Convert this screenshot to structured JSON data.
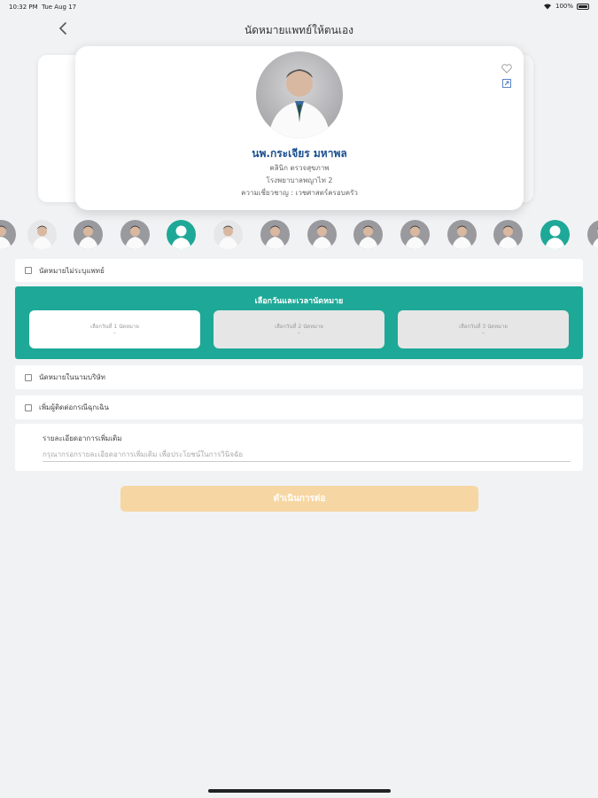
{
  "status_bar": {
    "time": "10:32 PM",
    "date": "Tue Aug 17",
    "battery": "100%"
  },
  "header": {
    "back_icon": "chevron-left-icon",
    "title": "นัดหมายแพทย์ให้ตนเอง"
  },
  "doctor": {
    "name": "นพ.กระเจียร มหาพล",
    "clinic": "คลินิก ตรวจสุขภาพ",
    "hospital": "โรงพยาบาลพญาไท 2",
    "specialty": "ความเชี่ยวชาญ : เวชศาสตร์ครอบครัว",
    "icons": [
      "heart-icon",
      "share-icon"
    ]
  },
  "avatars": [
    {
      "kind": "photo"
    },
    {
      "kind": "light"
    },
    {
      "kind": "photo"
    },
    {
      "kind": "photo"
    },
    {
      "kind": "generic"
    },
    {
      "kind": "light"
    },
    {
      "kind": "photo"
    },
    {
      "kind": "photo"
    },
    {
      "kind": "photo"
    },
    {
      "kind": "photo"
    },
    {
      "kind": "photo"
    },
    {
      "kind": "photo"
    },
    {
      "kind": "generic"
    },
    {
      "kind": "photo"
    }
  ],
  "options": {
    "no_doctor": "นัดหมายไม่ระบุแพทย์",
    "hotel_pickup": "นัดหมายในนามบริษัท",
    "emergency_contact": "เพิ่มผู้ติดต่อกรณีฉุกเฉิน"
  },
  "appointment": {
    "title": "เลือกวันและเวลานัดหมาย",
    "slots": [
      {
        "label": "เลือกวันที่ 1 นัดหมาย",
        "value": "-"
      },
      {
        "label": "เลือกวันที่ 2 นัดหมาย",
        "value": "-"
      },
      {
        "label": "เลือกวันที่ 3 นัดหมาย",
        "value": "-"
      }
    ]
  },
  "notes": {
    "label": "รายละเอียดอาการเพิ่มเติม",
    "placeholder": "กรุณากรอกรายละเอียดอาการเพิ่มเติม เพื่อประโยชน์ในการวินิจฉัย"
  },
  "continue_label": "ดำเนินการต่อ",
  "colors": {
    "accent": "#1ea897",
    "doctor_name": "#1b4f8f",
    "continue_button": "#f6d6a3"
  }
}
